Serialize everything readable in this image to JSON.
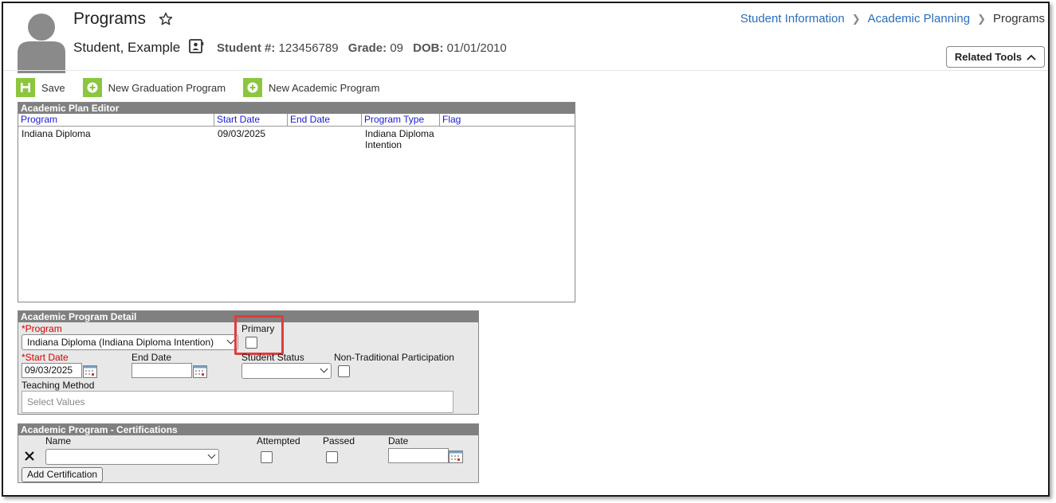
{
  "header": {
    "title": "Programs",
    "student_name": "Student, Example",
    "student_num_label": "Student #:",
    "student_num": "123456789",
    "grade_label": "Grade:",
    "grade": "09",
    "dob_label": "DOB:",
    "dob": "01/01/2010"
  },
  "breadcrumb": [
    "Student Information",
    "Academic Planning",
    "Programs"
  ],
  "related_tools": "Related Tools",
  "toolbar": {
    "save": "Save",
    "new_graduation": "New Graduation Program",
    "new_academic": "New Academic Program"
  },
  "editor": {
    "title": "Academic Plan Editor",
    "columns": [
      "Program",
      "Start Date",
      "End Date",
      "Program Type",
      "Flag"
    ],
    "rows": [
      {
        "program": "Indiana Diploma",
        "start_date": "09/03/2025",
        "end_date": "",
        "program_type": "Indiana Diploma Intention",
        "flag": ""
      }
    ]
  },
  "detail": {
    "title": "Academic Program Detail",
    "program_label": "*Program",
    "program_value": "Indiana Diploma (Indiana Diploma Intention)",
    "primary_label": "Primary",
    "start_label": "*Start Date",
    "start_value": "09/03/2025",
    "end_label": "End Date",
    "end_value": "",
    "status_label": "Student Status",
    "status_value": "",
    "nontrad_label": "Non-Traditional Participation",
    "teaching_label": "Teaching Method",
    "teaching_placeholder": "Select Values"
  },
  "cert": {
    "title": "Academic Program - Certifications",
    "name_label": "Name",
    "attempted_label": "Attempted",
    "passed_label": "Passed",
    "date_label": "Date",
    "add_button": "Add Certification"
  },
  "colors": {
    "accent_green": "#8cc63f",
    "link_blue": "#2a6ebb",
    "panel_header": "#808080",
    "required_red": "#d40000",
    "highlight_red": "#e03c3c"
  }
}
